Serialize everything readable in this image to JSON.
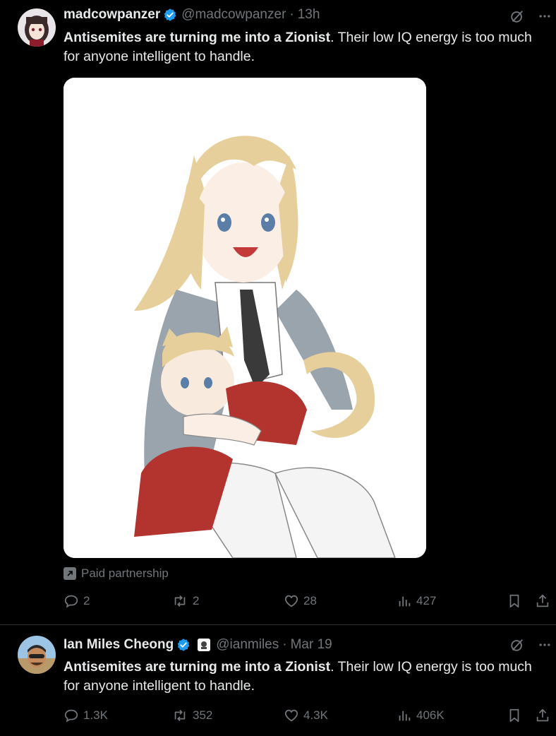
{
  "tweets": [
    {
      "author": {
        "display_name": "madcowpanzer",
        "handle": "@madcowpanzer",
        "verified": true
      },
      "separator": "·",
      "time": "13h",
      "text_bold": "Antisemites are turning me into a Zionist",
      "text_rest": ". Their low IQ energy is too much for anyone intelligent to handle.",
      "media": {
        "description": "anime illustration"
      },
      "paid_partnership_label": "Paid partnership",
      "stats": {
        "replies": "2",
        "reposts": "2",
        "likes": "28",
        "views": "427"
      },
      "icons": [
        "grok-icon",
        "more-icon",
        "reply-icon",
        "repost-icon",
        "like-icon",
        "views-icon",
        "bookmark-icon",
        "share-icon"
      ]
    },
    {
      "author": {
        "display_name": "Ian Miles Cheong",
        "handle": "@ianmiles",
        "verified": true
      },
      "separator": "·",
      "time": "Mar 19",
      "text_bold": "Antisemites are turning me into a Zionist",
      "text_rest": ". Their low IQ energy is too much for anyone intelligent to handle.",
      "stats": {
        "replies": "1.3K",
        "reposts": "352",
        "likes": "4.3K",
        "views": "406K"
      }
    }
  ],
  "colors": {
    "background": "#000000",
    "text": "#e7e9ea",
    "secondary": "#71767b",
    "verified": "#1d9bf0",
    "divider": "#2f3336"
  }
}
